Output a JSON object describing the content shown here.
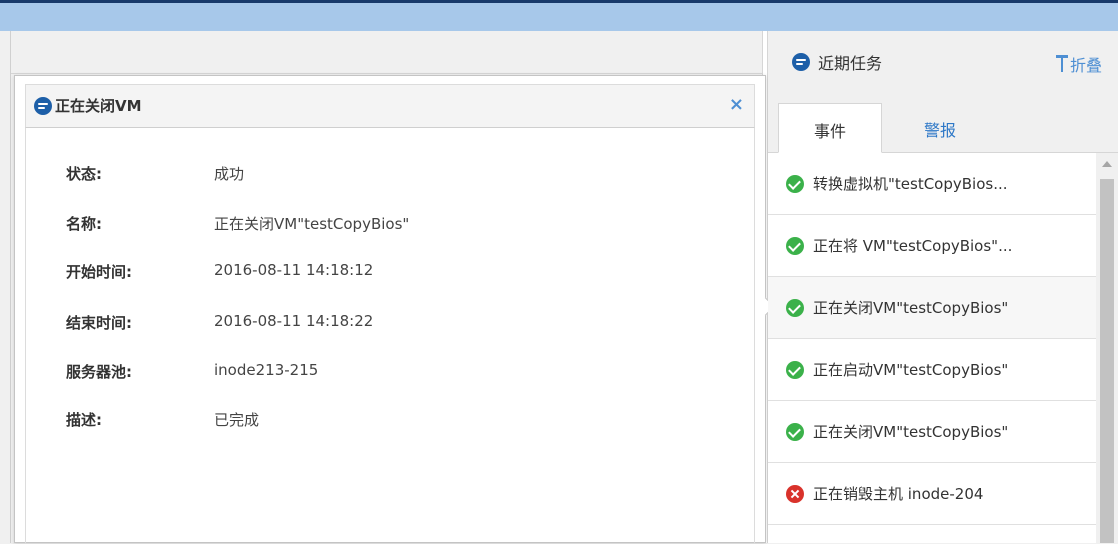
{
  "dialog": {
    "title": "正在关闭VM",
    "close_glyph": "×",
    "fields": [
      {
        "label": "状态:",
        "value": "成功"
      },
      {
        "label": "名称:",
        "value": "正在关闭VM\"testCopyBios\""
      },
      {
        "label": "开始时间:",
        "value": "2016-08-11 14:18:12"
      },
      {
        "label": "结束时间:",
        "value": "2016-08-11 14:18:22"
      },
      {
        "label": "服务器池:",
        "value": "inode213-215"
      },
      {
        "label": "描述:",
        "value": "已完成"
      }
    ]
  },
  "recent_tasks": {
    "title": "近期任务",
    "fold_label": "折叠",
    "tabs": [
      {
        "label": "事件",
        "active": true
      },
      {
        "label": "警报",
        "active": false
      }
    ],
    "items": [
      {
        "text": "转换虚拟机\"testCopyBios...",
        "status": "success"
      },
      {
        "text": "正在将 VM\"testCopyBios\"...",
        "status": "success"
      },
      {
        "text": "正在关闭VM\"testCopyBios\"",
        "status": "success",
        "selected": true
      },
      {
        "text": "正在启动VM\"testCopyBios\"",
        "status": "success"
      },
      {
        "text": "正在关闭VM\"testCopyBios\"",
        "status": "success"
      },
      {
        "text": "正在销毁主机 inode-204",
        "status": "error"
      }
    ]
  },
  "colors": {
    "accent": "#2e78c7",
    "success": "#3bb14a",
    "error": "#d9322b",
    "top_bar": "#a7c8ea"
  },
  "icons": {
    "title": "info-circle-icon",
    "close": "close-icon",
    "fold": "pin-icon",
    "success": "check-circle-icon",
    "error": "error-circle-icon"
  }
}
